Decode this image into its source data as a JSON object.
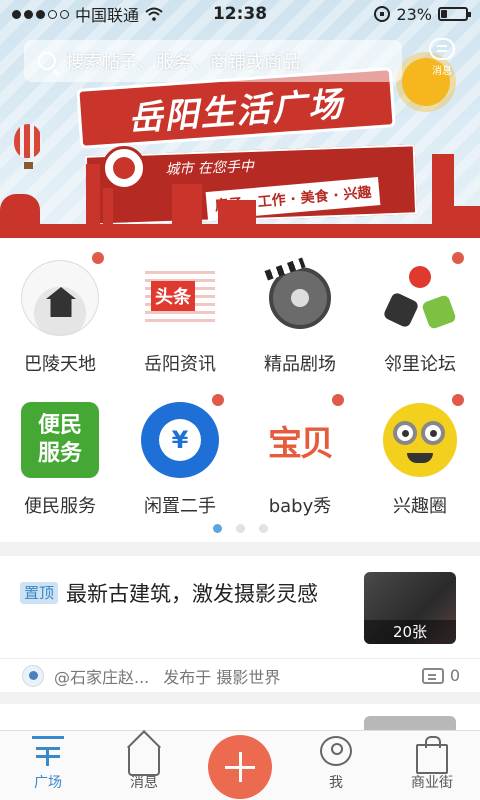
{
  "status_bar": {
    "carrier": "中国联通",
    "time": "12:38",
    "battery_percent": "23%",
    "battery_level": 0.23
  },
  "search": {
    "placeholder": "搜索帖子、服务、商铺或商品",
    "message_label": "消息"
  },
  "banner": {
    "title": "岳阳生活广场",
    "slogan": "城市 在您手中",
    "tags": "房子 · 工作 · 美食 · 兴趣"
  },
  "grid": {
    "items": [
      {
        "label": "巴陵天地",
        "icon": "baling-icon",
        "badge": true
      },
      {
        "label": "岳阳资讯",
        "icon": "toutiao-icon",
        "badge": false,
        "icon_text": "头条"
      },
      {
        "label": "精品剧场",
        "icon": "film-reel-icon",
        "badge": false
      },
      {
        "label": "邻里论坛",
        "icon": "neighbor-icon",
        "badge": true
      },
      {
        "label": "便民服务",
        "icon": "bianmin-icon",
        "badge": false,
        "icon_text": "便民服务"
      },
      {
        "label": "闲置二手",
        "icon": "yuan-search-icon",
        "badge": true,
        "icon_text": "¥"
      },
      {
        "label": "baby秀",
        "icon": "baby-icon",
        "badge": true,
        "icon_text": "宝贝"
      },
      {
        "label": "兴趣圈",
        "icon": "minion-icon",
        "badge": true
      }
    ],
    "pages": 3,
    "active_page": 1
  },
  "feed": {
    "pin_label": "置顶",
    "title": "最新古建筑，激发摄影灵感",
    "thumb_count": "20张",
    "author": "@石家庄赵...",
    "posted_in": "发布于 摄影世界",
    "comments": "0"
  },
  "tabs": [
    {
      "label": "广场",
      "icon": "square-icon",
      "active": true
    },
    {
      "label": "消息",
      "icon": "house-message-icon",
      "active": false
    },
    {
      "label": "",
      "icon": "plus-icon",
      "active": false
    },
    {
      "label": "我",
      "icon": "profile-icon",
      "active": false
    },
    {
      "label": "商业街",
      "icon": "shopping-bag-icon",
      "active": false
    }
  ],
  "colors": {
    "accent": "#3a89c9",
    "banner_red": "#c9342b",
    "plus_button": "#ec6b50",
    "badge_dot": "#e05a4a"
  }
}
